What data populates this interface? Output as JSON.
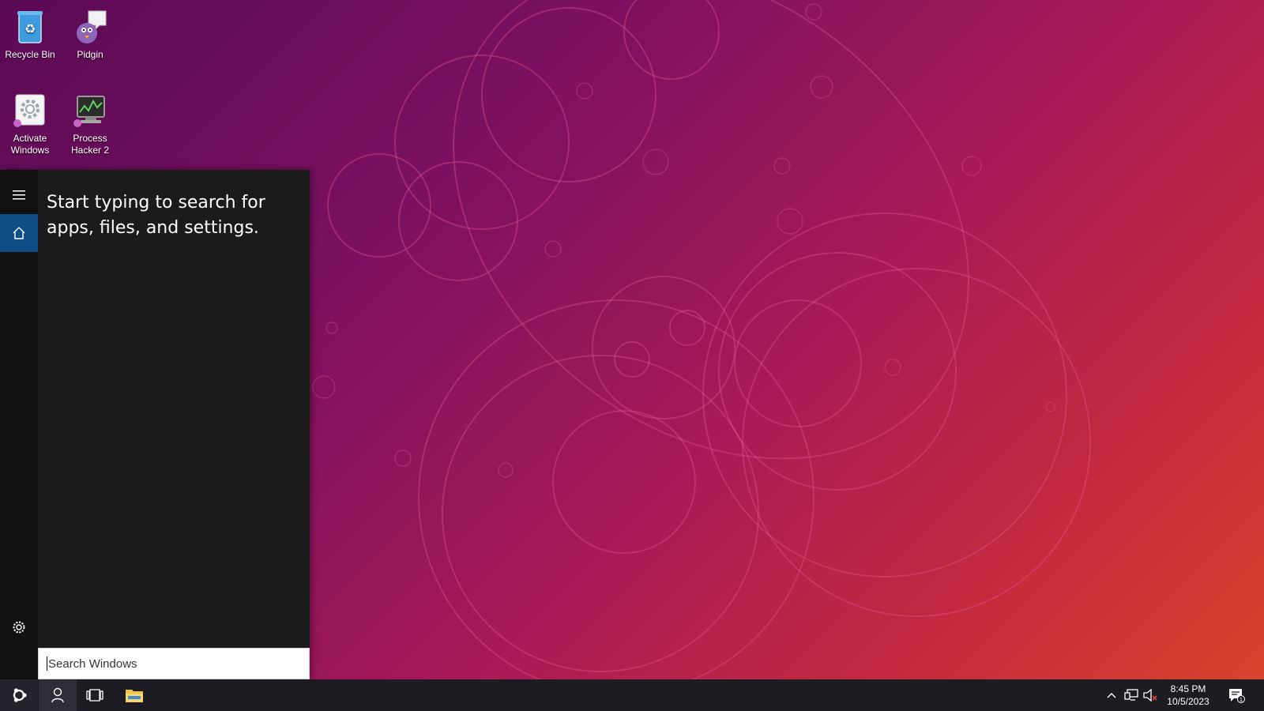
{
  "desktop": {
    "icons": [
      {
        "label": "Recycle Bin",
        "icon": "recycle-bin-icon"
      },
      {
        "label": "Pidgin",
        "icon": "pidgin-icon"
      },
      {
        "label": "Activate Windows",
        "icon": "activate-windows-icon"
      },
      {
        "label": "Process Hacker 2",
        "icon": "process-hacker-icon"
      }
    ]
  },
  "start_menu": {
    "hint": "Start typing to search for apps, files, and settings.",
    "rail": {
      "menu_icon": "hamburger-menu-icon",
      "home_icon": "home-icon",
      "settings_icon": "gear-icon"
    },
    "search": {
      "placeholder": "Search Windows"
    }
  },
  "taskbar": {
    "start_icon": "start-logo-icon",
    "search_icon": "search-person-icon",
    "task_view_icon": "task-view-icon",
    "file_explorer_icon": "folder-icon",
    "tray": {
      "chevron_icon": "chevron-up-icon",
      "network_icon": "network-icon",
      "volume_icon": "volume-muted-icon",
      "time": "8:45 PM",
      "date": "10/5/2023",
      "notification_icon": "notification-icon",
      "notification_count": "1"
    }
  },
  "colors": {
    "accent": "#0e4d85",
    "start_bg": "#1b1b1b",
    "taskbar_bg": "#1c1c22"
  }
}
